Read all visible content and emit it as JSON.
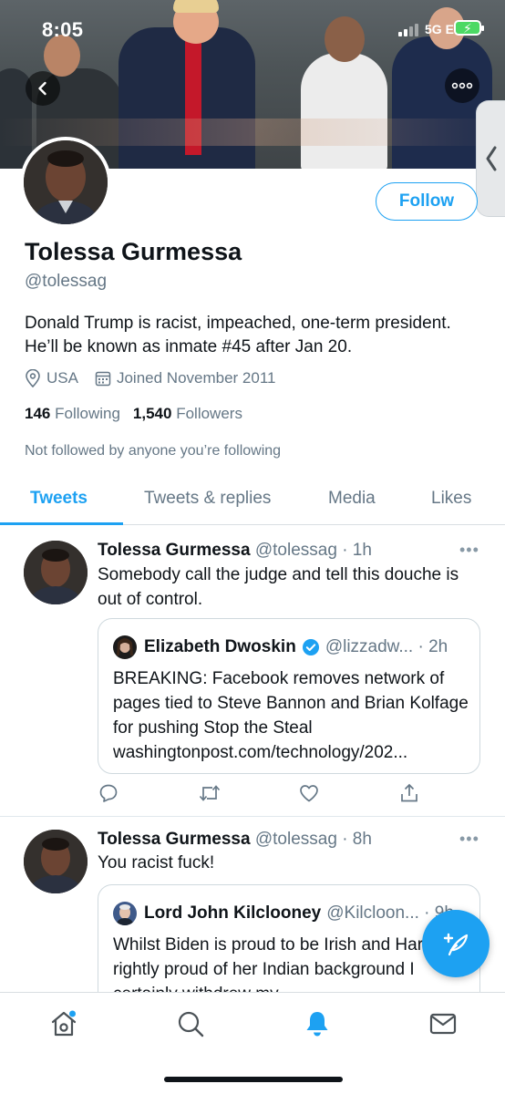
{
  "status_bar": {
    "time": "8:05",
    "network": "5G E"
  },
  "header": {
    "back_icon": "chevron-left-icon",
    "more_icon": "more-horizontal-icon"
  },
  "profile": {
    "name": "Tolessa Gurmessa",
    "handle": "@tolessag",
    "follow_label": "Follow",
    "bio": "Donald Trump is racist, impeached, one-term president. He’ll be known as inmate #45 after Jan 20.",
    "location": "USA",
    "joined": "Joined November 2011",
    "following_count": "146",
    "following_label": "Following",
    "followers_count": "1,540",
    "followers_label": "Followers",
    "not_followed_text": "Not followed by anyone you’re following"
  },
  "tabs": [
    {
      "label": "Tweets",
      "active": true
    },
    {
      "label": "Tweets & replies",
      "active": false
    },
    {
      "label": "Media",
      "active": false
    },
    {
      "label": "Likes",
      "active": false
    }
  ],
  "tweets": [
    {
      "author": "Tolessa Gurmessa",
      "meta": "@tolessag · 1h",
      "text": "Somebody call the judge and tell this douche is out of control.",
      "quote": {
        "author": "Elizabeth Dwoskin",
        "verified": true,
        "meta": "@lizzadw... · 2h",
        "text": "BREAKING: Facebook removes network of pages tied to Steve Bannon and Brian Kolfage for pushing Stop the Steal washingtonpost.com/technology/202..."
      }
    },
    {
      "author": "Tolessa Gurmessa",
      "meta": "@tolessag · 8h",
      "text": "You racist fuck!",
      "quote": {
        "author": "Lord John Kilclooney",
        "verified": false,
        "meta": "@Kilcloon... · 9h",
        "text": "Whilst Biden is proud to be Irish and Harris is rightly proud of her Indian background I certainly withdrew my"
      }
    }
  ],
  "colors": {
    "accent": "#1da1f2",
    "muted": "#657786",
    "text": "#0f1419",
    "border": "#cfd9de"
  },
  "bottom_nav": [
    "home-icon",
    "search-icon",
    "notifications-bell-icon",
    "messages-icon"
  ]
}
